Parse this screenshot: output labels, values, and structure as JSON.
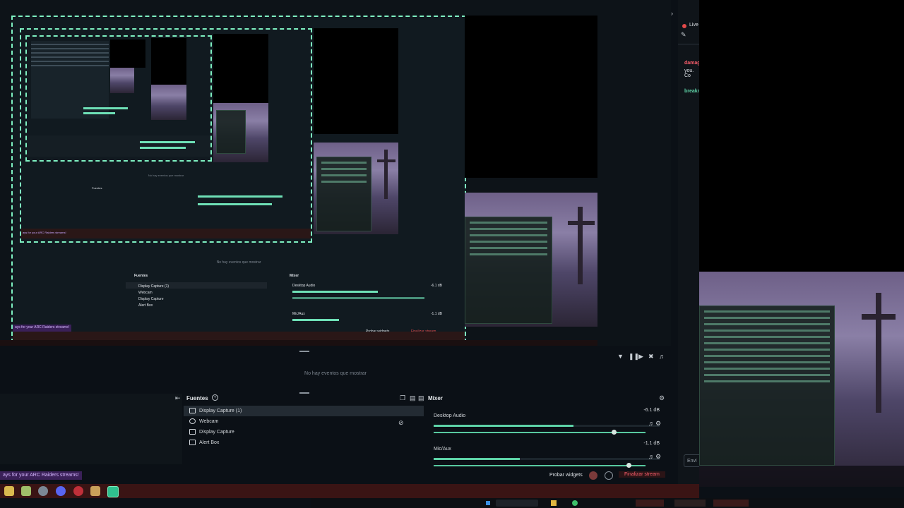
{
  "chat": {
    "live_label": "Live",
    "msg1_user": "damag",
    "msg1_text": "you. Co",
    "msg2_user": "breakn",
    "send_label": "Envi"
  },
  "events": {
    "empty_text": "No hay eventos que mostrar",
    "filter_icon": "filter-icon",
    "pause_icon": "pause-icon",
    "skip_icon": "skip-icon",
    "mute_icon": "mute-icon",
    "volume_icon": "volume-icon"
  },
  "sources": {
    "title": "Fuentes",
    "items": [
      {
        "label": "Display Capture (1)",
        "icon": "monitor-icon"
      },
      {
        "label": "Webcam",
        "icon": "camera-icon"
      },
      {
        "label": "Display Capture",
        "icon": "monitor-icon"
      },
      {
        "label": "Alert Box",
        "icon": "alert-icon"
      }
    ]
  },
  "mixer": {
    "title": "Mixer",
    "channels": [
      {
        "name": "Desktop Audio",
        "db": "-6.1 dB",
        "level": 0.62,
        "volume": 0.85
      },
      {
        "name": "Mic/Aux",
        "db": "-1.1 dB",
        "level": 0.38,
        "volume": 0.92
      }
    ]
  },
  "footer": {
    "banner": "ays for your ARC Raiders streams!",
    "probar_label": "Probar widgets",
    "finalizar_label": "Finalizar stream"
  },
  "nested": {
    "banner": "ays for your ARC Raiders streams!",
    "events_empty": "No hay eventos que mostrar",
    "fuentes": "Fuentes",
    "mixer": "Mixer",
    "desktop_audio": "Desktop Audio",
    "desktop_db": "-6.1 dB",
    "mic": "Mic/Aux",
    "mic_db": "-1.1 dB",
    "src1": "Display Capture (1)",
    "src2": "Webcam",
    "src3": "Display Capture",
    "src4": "Alert Box",
    "probar": "Probar widgets",
    "finalizar": "Finalizar stream"
  },
  "colors": {
    "accent": "#5ed3a7",
    "danger": "#e34a4a",
    "panel_bg": "#0b1016"
  }
}
